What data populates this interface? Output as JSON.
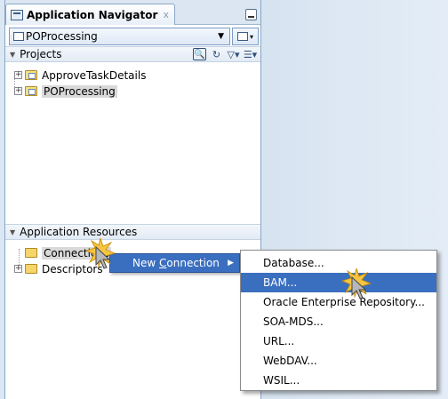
{
  "window": {
    "title": "Application Navigator",
    "close_glyph": "x",
    "minimize_icon": "minimize-icon"
  },
  "app_selector": {
    "value": "POProcessing"
  },
  "projects": {
    "header": "Projects",
    "items": [
      {
        "label": "ApproveTaskDetails",
        "selected": false
      },
      {
        "label": "POProcessing",
        "selected": true
      }
    ]
  },
  "resources": {
    "header": "Application Resources",
    "items": [
      {
        "label": "Connections",
        "selected": true
      },
      {
        "label": "Descriptors",
        "selected": false
      }
    ]
  },
  "context_menu": {
    "item_prefix": "New ",
    "item_mnemonic": "C",
    "item_rest": "onnection"
  },
  "submenu": {
    "items": [
      {
        "label": "Database...",
        "active": false
      },
      {
        "label": "BAM...",
        "active": true
      },
      {
        "label": "Oracle Enterprise Repository...",
        "active": false
      },
      {
        "label": "SOA-MDS...",
        "active": false
      },
      {
        "label": "URL...",
        "active": false
      },
      {
        "label": "WebDAV...",
        "active": false
      },
      {
        "label": "WSIL...",
        "active": false
      }
    ]
  },
  "colors": {
    "highlight": "#3a6fc0",
    "panel_bg": "#ffffff",
    "desktop_bg": "#dbe7f3"
  }
}
